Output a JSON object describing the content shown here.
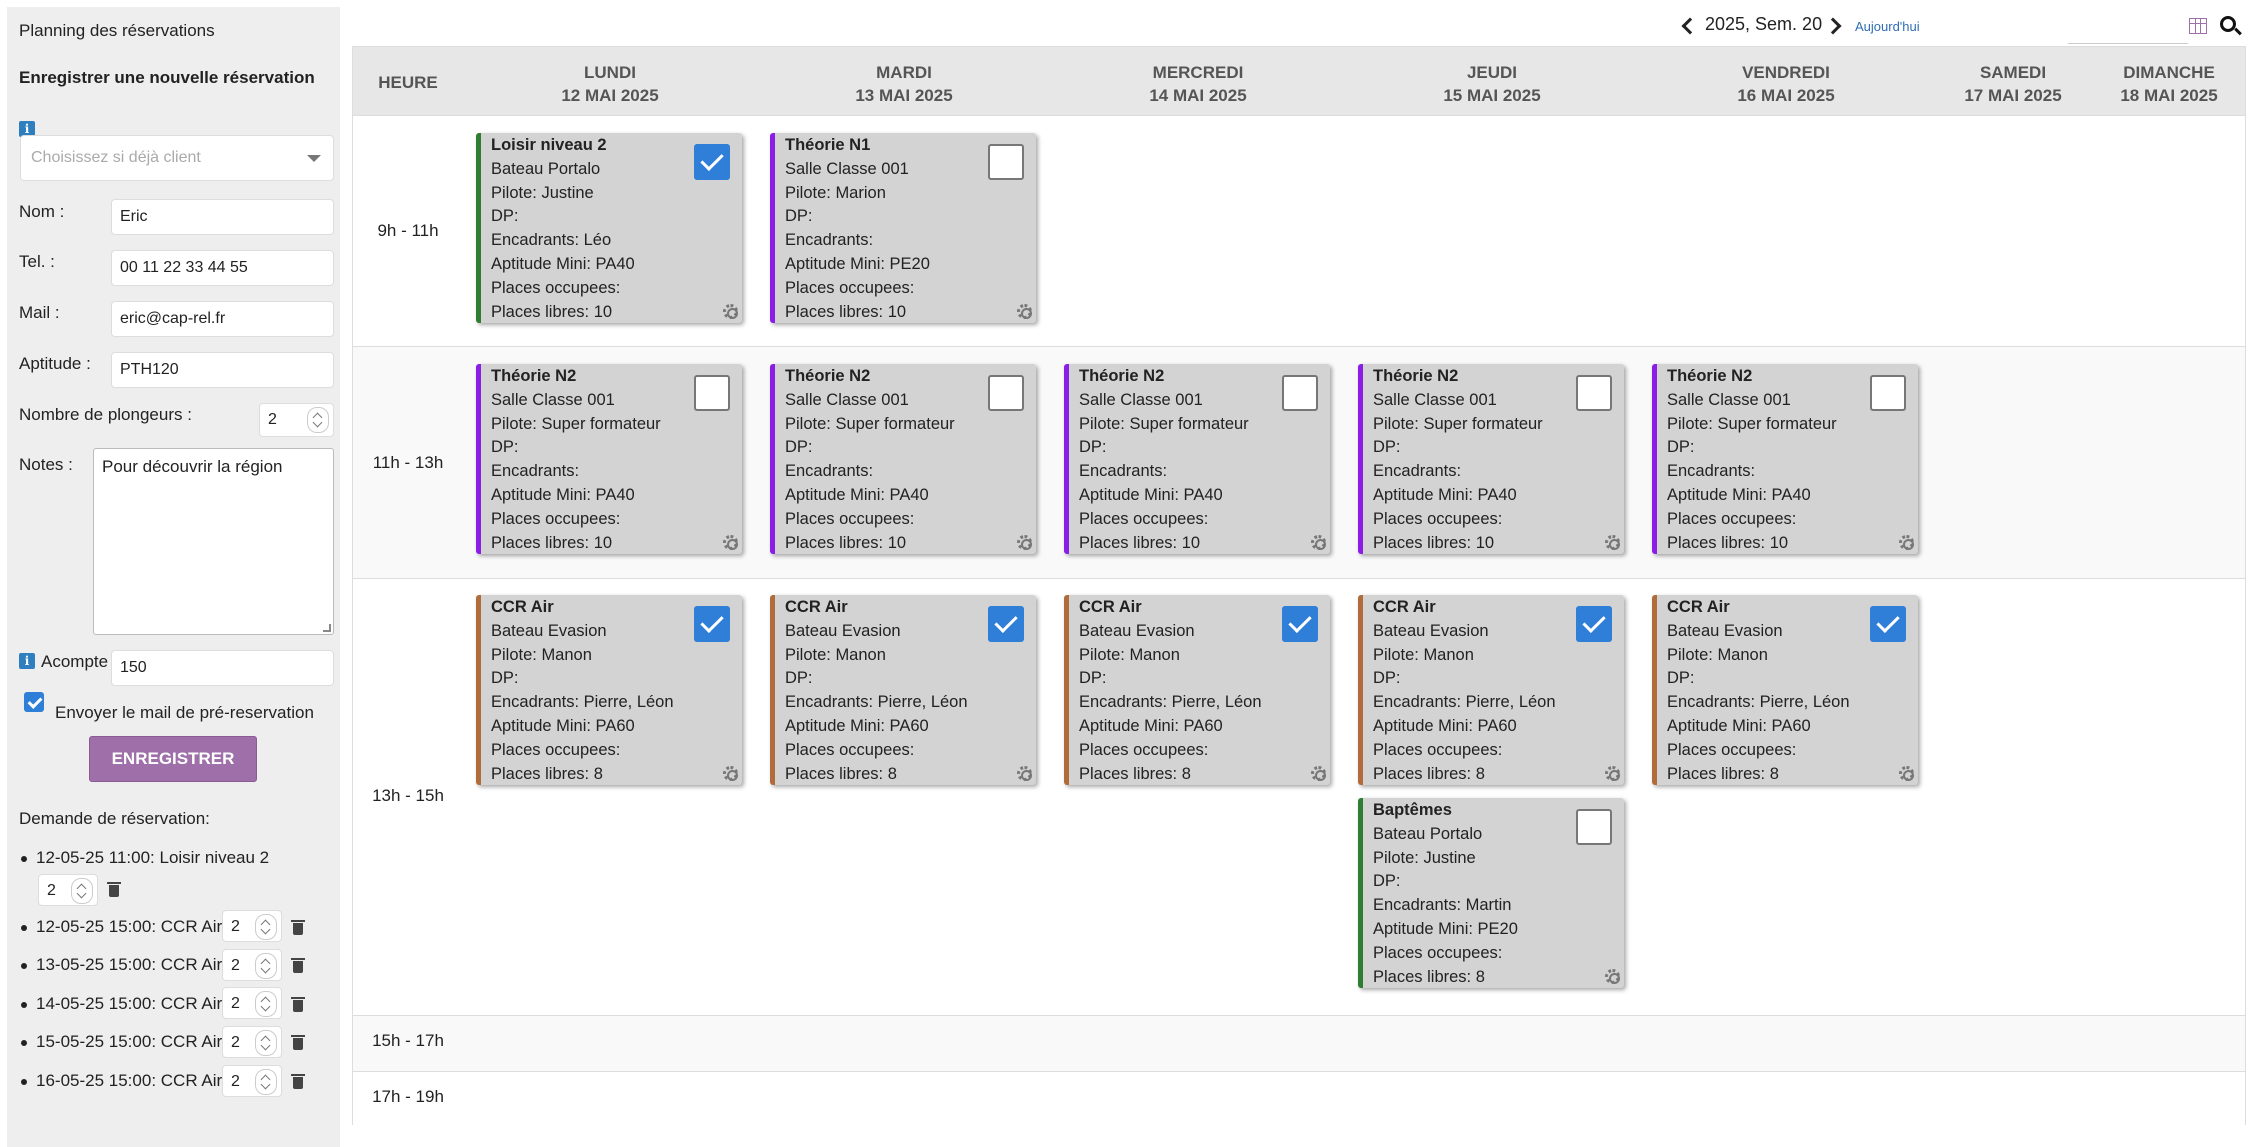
{
  "sidebar": {
    "title": "Planning des réservations",
    "subtitle": "Enregistrer une nouvelle réservation",
    "client_placeholder": "Choisissez si déjà client",
    "nom_label": "Nom :",
    "nom_value": "Eric",
    "tel_label": "Tel. :",
    "tel_value": "00 11 22 33 44 55",
    "mail_label": "Mail :",
    "mail_value": "eric@cap-rel.fr",
    "aptitude_label": "Aptitude :",
    "aptitude_value": "PTH120",
    "plongeurs_label": "Nombre de plongeurs :",
    "plongeurs_value": "2",
    "notes_label": "Notes :",
    "notes_value": "Pour découvrir la région",
    "acompte_label": "Acompte",
    "acompte_value": "150",
    "mail_checkbox_label": "Envoyer le mail de pré-reservation",
    "save_label": "ENREGISTRER",
    "requests_title": "Demande de réservation:",
    "requests": [
      {
        "text": "12-05-25 11:00: Loisir niveau 2",
        "qty": "2"
      },
      {
        "text": "12-05-25 15:00: CCR Air",
        "qty": "2"
      },
      {
        "text": "13-05-25 15:00: CCR Air",
        "qty": "2"
      },
      {
        "text": "14-05-25 15:00: CCR Air",
        "qty": "2"
      },
      {
        "text": "15-05-25 15:00: CCR Air",
        "qty": "2"
      },
      {
        "text": "16-05-25 15:00: CCR Air",
        "qty": "2"
      }
    ]
  },
  "topbar": {
    "week_label": "2025, Sem. 20",
    "today_label": "Aujourd'hui"
  },
  "calendar": {
    "hour_header": "HEURE",
    "days": [
      {
        "name": "LUNDI",
        "date": "12 MAI 2025"
      },
      {
        "name": "MARDI",
        "date": "13 MAI 2025"
      },
      {
        "name": "MERCREDI",
        "date": "14 MAI 2025"
      },
      {
        "name": "JEUDI",
        "date": "15 MAI 2025"
      },
      {
        "name": "VENDREDI",
        "date": "16 MAI 2025"
      },
      {
        "name": "SAMEDI",
        "date": "17 MAI 2025"
      },
      {
        "name": "DIMANCHE",
        "date": "18 MAI 2025"
      }
    ],
    "slots": [
      "9h - 11h",
      "11h - 13h",
      "13h - 15h",
      "15h - 17h",
      "17h - 19h"
    ],
    "events": [
      {
        "title": "Loisir niveau 2",
        "lines": [
          "Bateau Portalo",
          "Pilote: Justine",
          "DP:",
          "Encadrants: Léo",
          "Aptitude Mini: PA40",
          "Places occupees:",
          "Places libres: 10"
        ],
        "checked": true,
        "color": "#2e7d32"
      },
      {
        "title": "Théorie N1",
        "lines": [
          "Salle Classe 001",
          "Pilote: Marion",
          "DP:",
          "Encadrants:",
          "Aptitude Mini: PE20",
          "Places occupees:",
          "Places libres: 10"
        ],
        "checked": false,
        "color": "#8a1ee6"
      },
      {
        "title": "Théorie N2",
        "lines": [
          "Salle Classe 001",
          "Pilote: Super formateur",
          "DP:",
          "Encadrants:",
          "Aptitude Mini: PA40",
          "Places occupees:",
          "Places libres: 10"
        ],
        "checked": false,
        "color": "#8a1ee6"
      },
      {
        "title": "Théorie N2",
        "lines": [
          "Salle Classe 001",
          "Pilote: Super formateur",
          "DP:",
          "Encadrants:",
          "Aptitude Mini: PA40",
          "Places occupees:",
          "Places libres: 10"
        ],
        "checked": false,
        "color": "#8a1ee6"
      },
      {
        "title": "Théorie N2",
        "lines": [
          "Salle Classe 001",
          "Pilote: Super formateur",
          "DP:",
          "Encadrants:",
          "Aptitude Mini: PA40",
          "Places occupees:",
          "Places libres: 10"
        ],
        "checked": false,
        "color": "#8a1ee6"
      },
      {
        "title": "Théorie N2",
        "lines": [
          "Salle Classe 001",
          "Pilote: Super formateur",
          "DP:",
          "Encadrants:",
          "Aptitude Mini: PA40",
          "Places occupees:",
          "Places libres: 10"
        ],
        "checked": false,
        "color": "#8a1ee6"
      },
      {
        "title": "Théorie N2",
        "lines": [
          "Salle Classe 001",
          "Pilote: Super formateur",
          "DP:",
          "Encadrants:",
          "Aptitude Mini: PA40",
          "Places occupees:",
          "Places libres: 10"
        ],
        "checked": false,
        "color": "#8a1ee6"
      },
      {
        "title": "CCR Air",
        "lines": [
          "Bateau Evasion",
          "Pilote: Manon",
          "DP:",
          "Encadrants: Pierre, Léon",
          "Aptitude Mini: PA60",
          "Places occupees:",
          "Places libres: 8"
        ],
        "checked": true,
        "color": "#b06c3a"
      },
      {
        "title": "CCR Air",
        "lines": [
          "Bateau Evasion",
          "Pilote: Manon",
          "DP:",
          "Encadrants: Pierre, Léon",
          "Aptitude Mini: PA60",
          "Places occupees:",
          "Places libres: 8"
        ],
        "checked": true,
        "color": "#b06c3a"
      },
      {
        "title": "CCR Air",
        "lines": [
          "Bateau Evasion",
          "Pilote: Manon",
          "DP:",
          "Encadrants: Pierre, Léon",
          "Aptitude Mini: PA60",
          "Places occupees:",
          "Places libres: 8"
        ],
        "checked": true,
        "color": "#b06c3a"
      },
      {
        "title": "CCR Air",
        "lines": [
          "Bateau Evasion",
          "Pilote: Manon",
          "DP:",
          "Encadrants: Pierre, Léon",
          "Aptitude Mini: PA60",
          "Places occupees:",
          "Places libres: 8"
        ],
        "checked": true,
        "color": "#b06c3a"
      },
      {
        "title": "CCR Air",
        "lines": [
          "Bateau Evasion",
          "Pilote: Manon",
          "DP:",
          "Encadrants: Pierre, Léon",
          "Aptitude Mini: PA60",
          "Places occupees:",
          "Places libres: 8"
        ],
        "checked": true,
        "color": "#b06c3a"
      },
      {
        "title": "Baptêmes",
        "lines": [
          "Bateau Portalo",
          "Pilote: Justine",
          "DP:",
          "Encadrants: Martin",
          "Aptitude Mini: PE20",
          "Places occupees:",
          "Places libres: 8"
        ],
        "checked": false,
        "color": "#2e7d32"
      }
    ]
  }
}
